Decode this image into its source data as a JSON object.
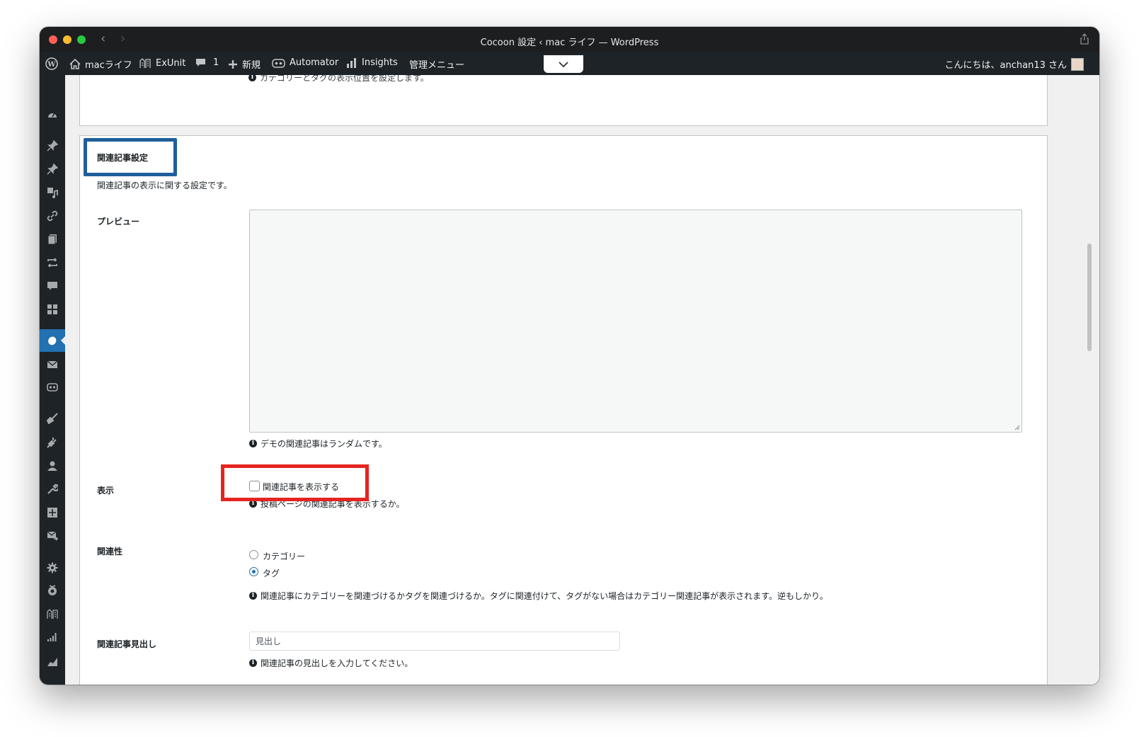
{
  "window": {
    "title": "Cocoon 設定 ‹ mac ライフ — WordPress"
  },
  "adminbar": {
    "site_name": "macライフ",
    "exunit": "ExUnit",
    "comments_count": "1",
    "new_label": "新規",
    "automator": "Automator",
    "insights": "Insights",
    "admin_menu": "管理メニュー",
    "greeting": "こんにちは、anchan13 さん"
  },
  "top_panel": {
    "partial_note": "カテゴリーとタグの表示位置を設定します。"
  },
  "section": {
    "title": "関連記事設定",
    "description": "関連記事の表示に関する設定です。"
  },
  "preview": {
    "label": "プレビュー",
    "note": "デモの関連記事はランダムです。"
  },
  "display": {
    "label": "表示",
    "checkbox_label": "関連記事を表示する",
    "checked": false,
    "note": "投稿ページの関連記事を表示するか。"
  },
  "relevance": {
    "label": "関連性",
    "options": [
      "カテゴリー",
      "タグ"
    ],
    "selected": "タグ",
    "note": "関連記事にカテゴリーを関連づけるかタグを関連づけるか。タグに関連付けて、タグがない場合はカテゴリー関連記事が表示されます。逆もしかり。"
  },
  "heading": {
    "label": "関連記事見出し",
    "value": "見出し",
    "note": "関連記事の見出しを入力してください。"
  },
  "colors": {
    "adminbar_bg": "#1d2327",
    "active_menu": "#2271b1",
    "highlight_blue": "#1f5f99",
    "highlight_red": "#e52420"
  }
}
